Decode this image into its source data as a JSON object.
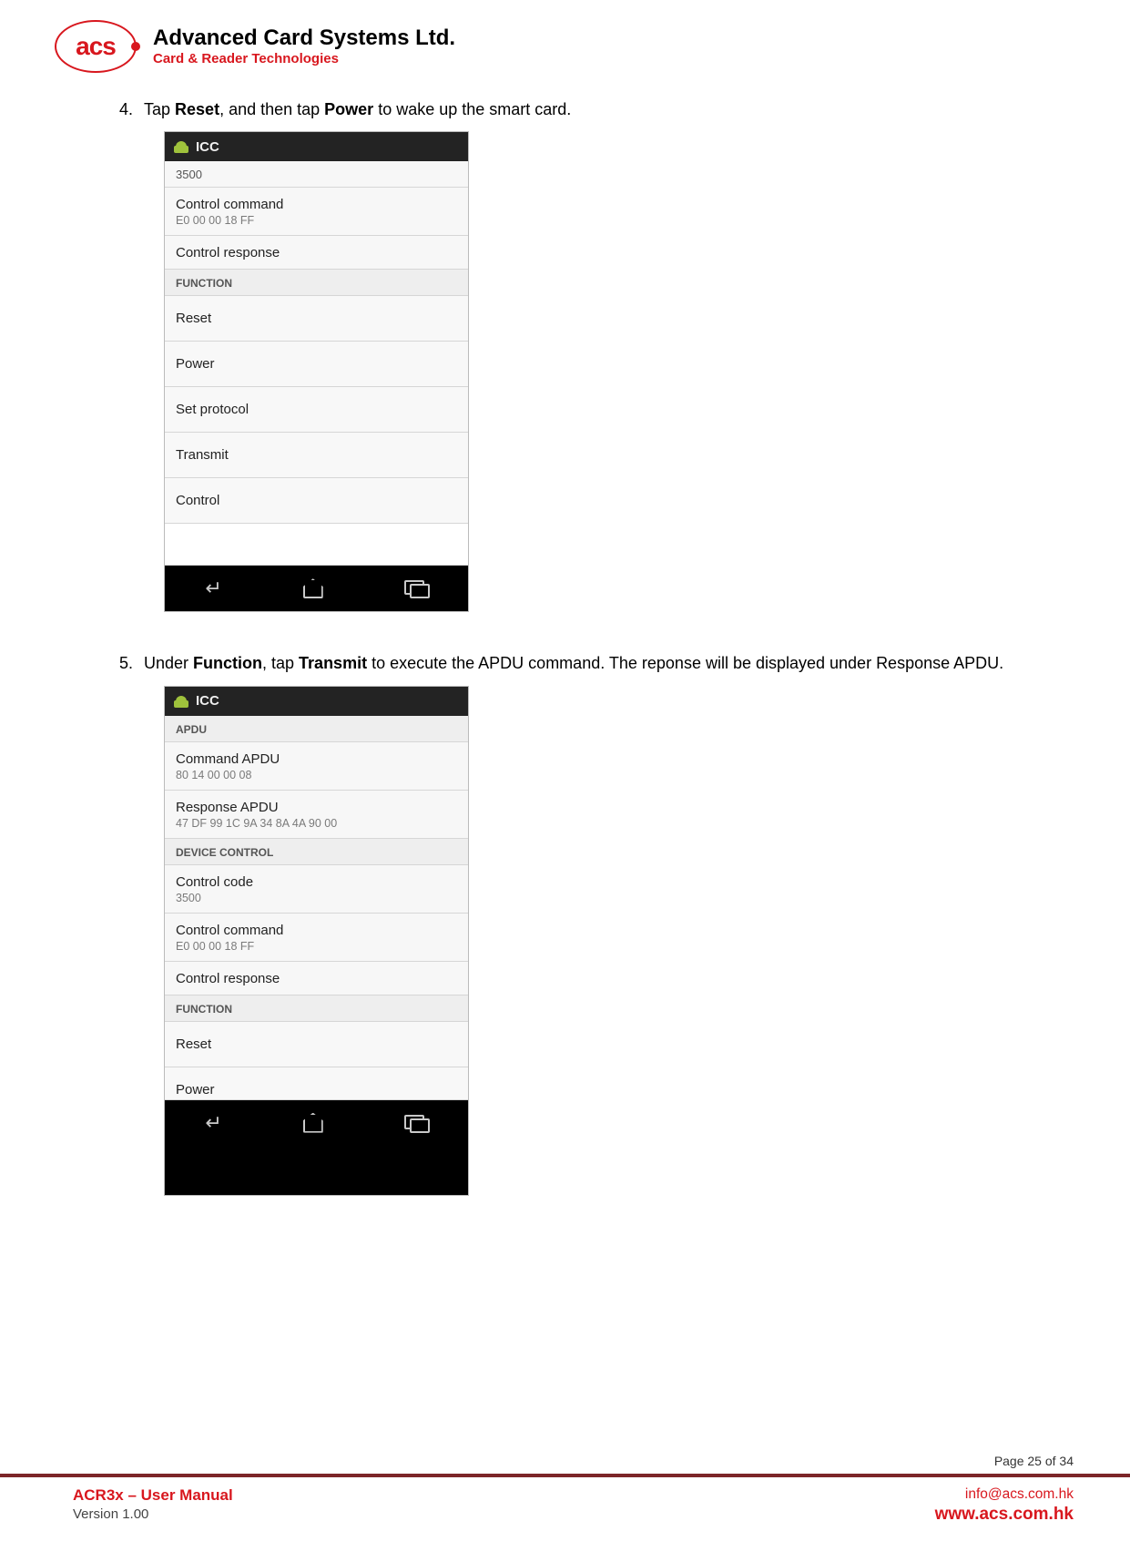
{
  "header": {
    "logo_text": "acs",
    "company": "Advanced Card Systems Ltd.",
    "tagline": "Card & Reader Technologies"
  },
  "steps": {
    "s4": {
      "num": "4.",
      "pre": "Tap ",
      "b1": "Reset",
      "mid": ", and then tap ",
      "b2": "Power",
      "post": " to wake up the smart card."
    },
    "s5": {
      "num": "5.",
      "pre": "Under ",
      "b1": "Function",
      "mid": ", tap ",
      "b2": "Transmit",
      "post": " to execute the APDU command. The reponse will be displayed under Response APDU."
    }
  },
  "phone1": {
    "title": "ICC",
    "r0": "3500",
    "r1_title": "Control command",
    "r1_sub": "E0 00 00 18 FF",
    "r2_title": "Control response",
    "sect": "FUNCTION",
    "a1": "Reset",
    "a2": "Power",
    "a3": "Set protocol",
    "a4": "Transmit",
    "a5": "Control"
  },
  "phone2": {
    "title": "ICC",
    "sectA": "APDU",
    "cmd_title": "Command APDU",
    "cmd_sub": "80 14 00 00 08",
    "resp_title": "Response APDU",
    "resp_sub": "47 DF 99 1C 9A 34 8A 4A 90 00",
    "sectB": "DEVICE CONTROL",
    "code_title": "Control code",
    "code_sub": "3500",
    "ccmd_title": "Control command",
    "ccmd_sub": "E0 00 00 18 FF",
    "cresp_title": "Control response",
    "sectC": "FUNCTION",
    "a1": "Reset",
    "a2": "Power"
  },
  "footer": {
    "page": "Page 25 of 34",
    "doc_title": "ACR3x – User Manual",
    "version": "Version 1.00",
    "email": "info@acs.com.hk",
    "site": "www.acs.com.hk"
  }
}
